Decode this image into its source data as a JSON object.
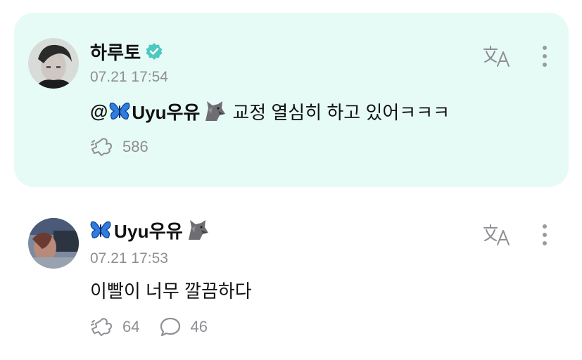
{
  "post": {
    "author": "하루토",
    "verified": true,
    "time": "07.21 17:54",
    "mention": "@",
    "mention_name": "Uyu우유",
    "text": "교정 열심히 하고 있어ㅋㅋㅋ",
    "likes": "586",
    "icons": {
      "verified": "verified-badge-icon",
      "translate": "translate-icon",
      "more": "more-vertical-icon",
      "like": "heart-hand-icon"
    }
  },
  "reply": {
    "author": "Uyu우유",
    "time": "07.21 17:53",
    "text": "이빨이 너무 깔끔하다",
    "likes": "64",
    "comments": "46",
    "icons": {
      "translate": "translate-icon",
      "more": "more-vertical-icon",
      "like": "heart-hand-icon",
      "comment": "comment-bubble-icon"
    }
  },
  "colors": {
    "highlight_bg": "#e7fbf6",
    "verified": "#4cc9c1",
    "muted": "#8e8e93"
  }
}
